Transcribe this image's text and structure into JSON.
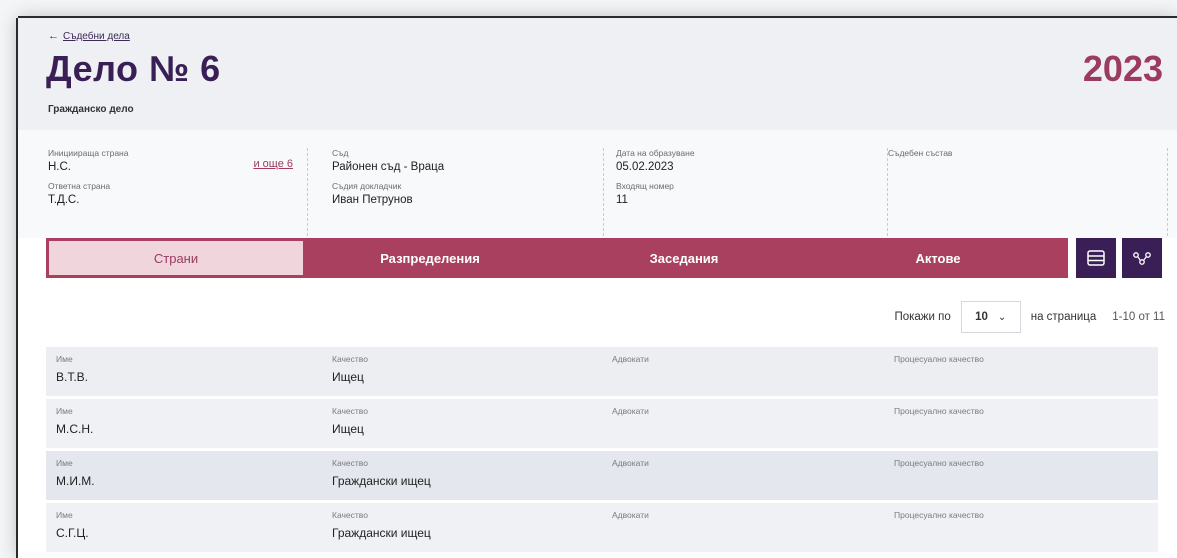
{
  "breadcrumb": {
    "back_label": "Съдебни дела"
  },
  "case": {
    "title": "Дело № 6",
    "type": "Гражданско дело",
    "year": "2023"
  },
  "info": {
    "initiating_party": {
      "label": "Инициираща страна",
      "value": "Н.С.",
      "more": "и още 6"
    },
    "responding_party": {
      "label": "Ответна страна",
      "value": "Т.Д.С."
    },
    "court": {
      "label": "Съд",
      "value": "Районен съд - Враца"
    },
    "reporting_judge": {
      "label": "Съдия докладчик",
      "value": "Иван Петрунов"
    },
    "creation_date": {
      "label": "Дата на образуване",
      "value": "05.02.2023"
    },
    "incoming_number": {
      "label": "Входящ номер",
      "value": "11"
    },
    "panel": {
      "label": "Съдебен състав",
      "value": ""
    }
  },
  "tabs": [
    {
      "label": "Страни",
      "active": true
    },
    {
      "label": "Разпределения",
      "active": false
    },
    {
      "label": "Заседания",
      "active": false
    },
    {
      "label": "Актове",
      "active": false
    }
  ],
  "toolbar_icons": [
    "layout-icon",
    "share-nodes-icon"
  ],
  "pagination": {
    "show_label": "Покажи по",
    "per_page": "10",
    "per_page_suffix": "на страница",
    "range": "1-10 от 11"
  },
  "columns": {
    "name": "Име",
    "role": "Качество",
    "lawyers": "Адвокати",
    "procedural_role": "Процесуално качество"
  },
  "parties": [
    {
      "name": "В.Т.В.",
      "role": "Ищец",
      "lawyers": "",
      "procedural_role": ""
    },
    {
      "name": "М.С.Н.",
      "role": "Ищец",
      "lawyers": "",
      "procedural_role": ""
    },
    {
      "name": "М.И.М.",
      "role": "Граждански ищец",
      "lawyers": "",
      "procedural_role": ""
    },
    {
      "name": "С.Г.Ц.",
      "role": "Граждански ищец",
      "lawyers": "",
      "procedural_role": ""
    }
  ],
  "colors": {
    "brand_dark": "#3a1f57",
    "accent": "#9c3a60",
    "tab_bar": "#a9405f",
    "tab_active_bg": "#f0d5dd"
  }
}
